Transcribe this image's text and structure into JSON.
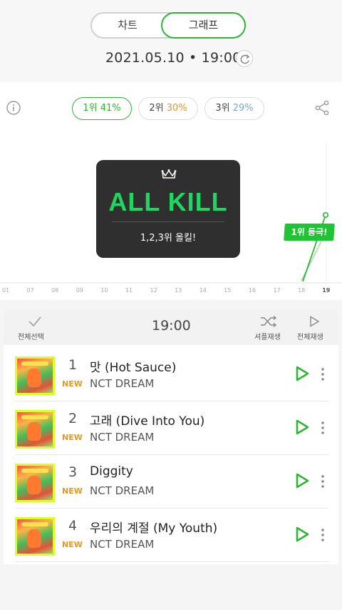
{
  "header": {
    "tabs": [
      "차트",
      "그래프"
    ],
    "active_tab": "그래프",
    "datetime": "2021.05.10 • 19:00"
  },
  "filters": {
    "rank1_label": "1위",
    "rank1_pct": "41%",
    "rank2_label": "2위",
    "rank2_pct": "30%",
    "rank3_label": "3위",
    "rank3_pct": "29%"
  },
  "allkill": {
    "title": "ALL KILL",
    "subtitle": "1,2,3위 올킬!"
  },
  "chart_data": {
    "type": "line",
    "x": [
      "01",
      "07",
      "08",
      "09",
      "10",
      "11",
      "12",
      "13",
      "14",
      "15",
      "16",
      "17",
      "18",
      "19"
    ],
    "series": [],
    "annotation": "1위 등극!"
  },
  "list": {
    "select_all": "전체선택",
    "time": "19:00",
    "shuffle": "셔플재생",
    "play_all": "전체재생",
    "songs": [
      {
        "rank": "1",
        "badge": "NEW",
        "title": "맛 (Hot Sauce)",
        "artist": "NCT DREAM"
      },
      {
        "rank": "2",
        "badge": "NEW",
        "title": "고래 (Dive Into You)",
        "artist": "NCT DREAM"
      },
      {
        "rank": "3",
        "badge": "NEW",
        "title": "Diggity",
        "artist": "NCT DREAM"
      },
      {
        "rank": "4",
        "badge": "NEW",
        "title": "우리의 계절 (My Youth)",
        "artist": "NCT DREAM"
      }
    ]
  },
  "colors": {
    "accent": "#2fb536",
    "new_badge": "#e39a26",
    "allkill_green": "#1ed760",
    "cover_frame": "#d8ff2a"
  }
}
